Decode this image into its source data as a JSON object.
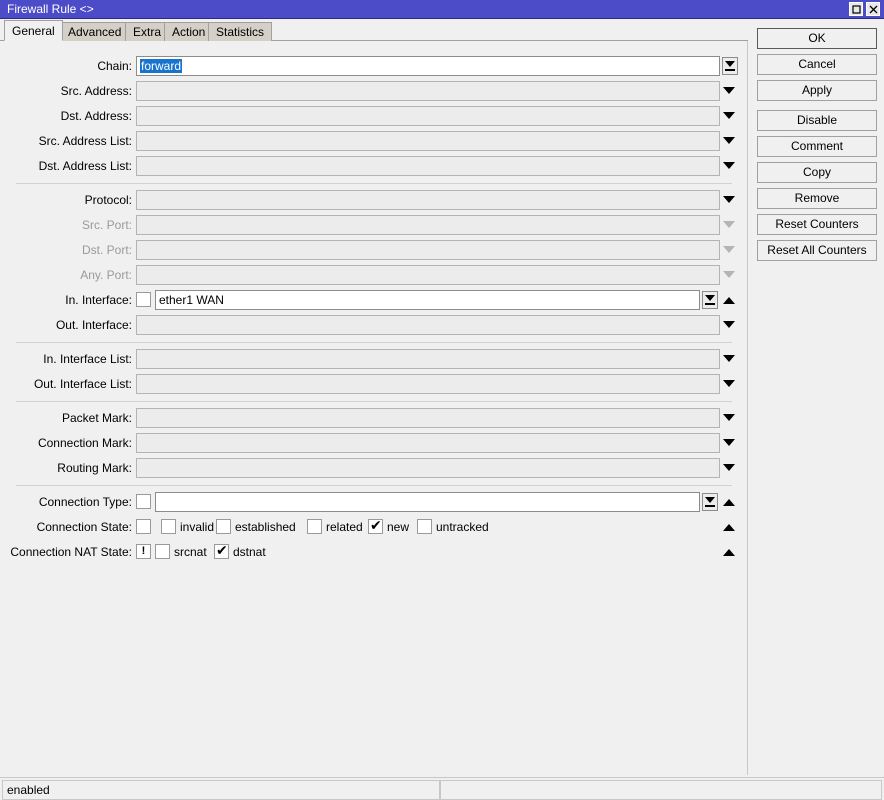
{
  "window": {
    "title": "Firewall Rule <>",
    "titlebar_color": "#4c4cc8",
    "maximize_icon": "maximize-icon",
    "close_icon": "close-icon"
  },
  "tabs": [
    {
      "label": "General",
      "active": true
    },
    {
      "label": "Advanced",
      "active": false
    },
    {
      "label": "Extra",
      "active": false
    },
    {
      "label": "Action",
      "active": false
    },
    {
      "label": "Statistics",
      "active": false
    }
  ],
  "fields": {
    "chain": {
      "label": "Chain:",
      "value": "forward",
      "selected": true
    },
    "src_address": {
      "label": "Src. Address:",
      "value": ""
    },
    "dst_address": {
      "label": "Dst. Address:",
      "value": ""
    },
    "src_address_list": {
      "label": "Src. Address List:",
      "value": ""
    },
    "dst_address_list": {
      "label": "Dst. Address List:",
      "value": ""
    },
    "protocol": {
      "label": "Protocol:",
      "value": ""
    },
    "src_port": {
      "label": "Src. Port:",
      "value": "",
      "disabled": true
    },
    "dst_port": {
      "label": "Dst. Port:",
      "value": "",
      "disabled": true
    },
    "any_port": {
      "label": "Any. Port:",
      "value": "",
      "disabled": true
    },
    "in_interface": {
      "label": "In. Interface:",
      "value": "ether1 WAN",
      "negate": false
    },
    "out_interface": {
      "label": "Out. Interface:",
      "value": ""
    },
    "in_interface_list": {
      "label": "In. Interface List:",
      "value": ""
    },
    "out_interface_list": {
      "label": "Out. Interface List:",
      "value": ""
    },
    "packet_mark": {
      "label": "Packet Mark:",
      "value": ""
    },
    "connection_mark": {
      "label": "Connection Mark:",
      "value": ""
    },
    "routing_mark": {
      "label": "Routing Mark:",
      "value": ""
    },
    "connection_type": {
      "label": "Connection Type:",
      "value": "",
      "negate": false
    },
    "connection_state": {
      "label": "Connection State:",
      "negate": false,
      "options": [
        {
          "label": "invalid",
          "checked": false
        },
        {
          "label": "established",
          "checked": false
        },
        {
          "label": "related",
          "checked": false
        },
        {
          "label": "new",
          "checked": true
        },
        {
          "label": "untracked",
          "checked": false
        }
      ]
    },
    "connection_nat_state": {
      "label": "Connection NAT State:",
      "negate": true,
      "negate_glyph": "!",
      "options": [
        {
          "label": "srcnat",
          "checked": false
        },
        {
          "label": "dstnat",
          "checked": true
        }
      ]
    }
  },
  "buttons": [
    {
      "label": "OK",
      "focused": true
    },
    {
      "label": "Cancel",
      "focused": false
    },
    {
      "label": "Apply",
      "focused": false
    },
    {
      "label": "Disable",
      "focused": false
    },
    {
      "label": "Comment",
      "focused": false
    },
    {
      "label": "Copy",
      "focused": false
    },
    {
      "label": "Remove",
      "focused": false
    },
    {
      "label": "Reset Counters",
      "focused": false
    },
    {
      "label": "Reset All Counters",
      "focused": false
    }
  ],
  "statusbar": {
    "left_text": "enabled",
    "right_text": ""
  }
}
